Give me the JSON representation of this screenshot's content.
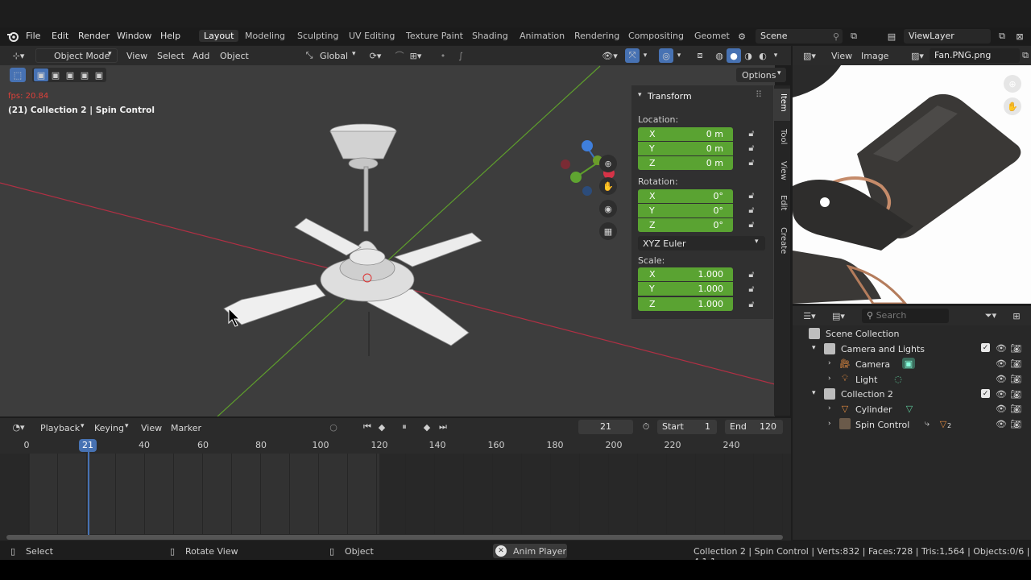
{
  "topbar": {
    "menus": [
      "File",
      "Edit",
      "Render",
      "Window",
      "Help"
    ],
    "workspaces": [
      "Layout",
      "Modeling",
      "Sculpting",
      "UV Editing",
      "Texture Paint",
      "Shading",
      "Animation",
      "Rendering",
      "Compositing",
      "Geomet"
    ],
    "scene": "Scene",
    "view_layer": "ViewLayer"
  },
  "viewport_header": {
    "mode": "Object Mode",
    "menus": [
      "View",
      "Select",
      "Add",
      "Object"
    ],
    "transform_orientation": "Global",
    "options_label": "Options"
  },
  "viewport": {
    "fps": "fps: 20.84",
    "info": "(21) Collection 2 | Spin Control"
  },
  "npanel": {
    "title": "Transform",
    "location_label": "Location:",
    "rotation_label": "Rotation:",
    "scale_label": "Scale:",
    "location": [
      {
        "axis": "X",
        "value": "0 m"
      },
      {
        "axis": "Y",
        "value": "0 m"
      },
      {
        "axis": "Z",
        "value": "0 m"
      }
    ],
    "rotation": [
      {
        "axis": "X",
        "value": "0°"
      },
      {
        "axis": "Y",
        "value": "0°"
      },
      {
        "axis": "Z",
        "value": "0°"
      }
    ],
    "rotation_mode": "XYZ Euler",
    "scale": [
      {
        "axis": "X",
        "value": "1.000"
      },
      {
        "axis": "Y",
        "value": "1.000"
      },
      {
        "axis": "Z",
        "value": "1.000"
      }
    ],
    "tabs": [
      "Item",
      "Tool",
      "View",
      "Edit",
      "Create"
    ]
  },
  "image_editor": {
    "menus": [
      "View",
      "Image"
    ],
    "image_name": "Fan.PNG.png"
  },
  "outliner": {
    "search_placeholder": "Search",
    "root": "Scene Collection",
    "items": [
      {
        "name": "Camera and Lights",
        "type": "collection"
      },
      {
        "name": "Camera",
        "type": "camera"
      },
      {
        "name": "Light",
        "type": "light"
      },
      {
        "name": "Collection 2",
        "type": "collection"
      },
      {
        "name": "Cylinder",
        "type": "mesh"
      },
      {
        "name": "Spin Control",
        "type": "empty"
      }
    ],
    "constraint_badge": "2"
  },
  "timeline": {
    "menus": [
      "Playback",
      "Keying",
      "View",
      "Marker"
    ],
    "current_frame": "21",
    "start_label": "Start",
    "start": "1",
    "end_label": "End",
    "end": "120",
    "ticks": [
      "0",
      "21",
      "40",
      "60",
      "80",
      "100",
      "120",
      "140",
      "160",
      "180",
      "200",
      "220",
      "240"
    ]
  },
  "statusbar": {
    "select": "Select",
    "rotate": "Rotate View",
    "object": "Object",
    "anim_player": "Anim Player",
    "stats": "Collection 2 | Spin Control | Verts:832 | Faces:728 | Tris:1,564 | Objects:0/6 | 4.1.1"
  },
  "colors": {
    "accent": "#4772b3",
    "field_green": "#5aa332",
    "x_axis": "#b03044",
    "y_axis": "#5e9e2c"
  }
}
